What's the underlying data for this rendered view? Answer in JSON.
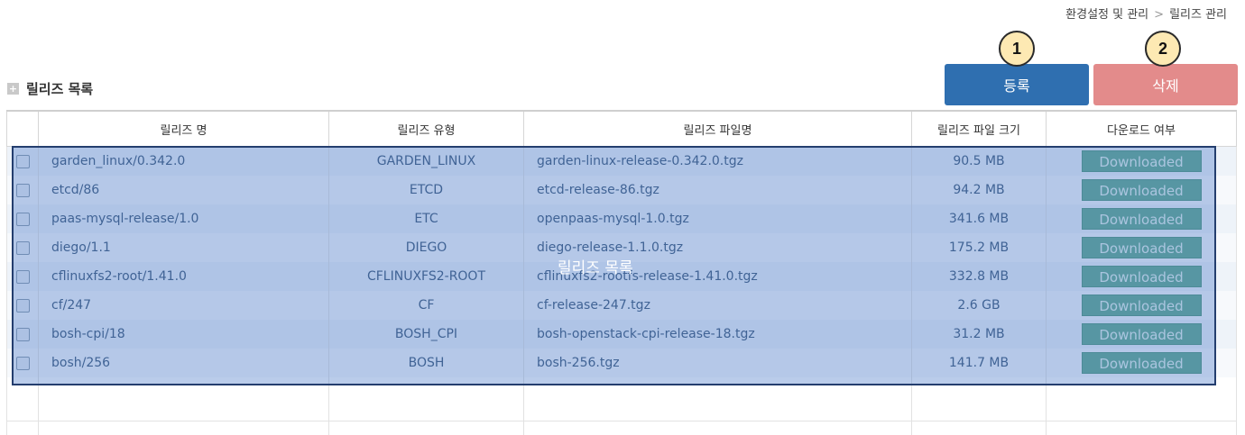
{
  "breadcrumb": {
    "parent": "환경설정 및 관리",
    "separator": ">",
    "current": "릴리즈 관리"
  },
  "section": {
    "title": "릴리즈 목록",
    "icon": "plus-icon"
  },
  "buttons": {
    "register": "등록",
    "delete": "삭제"
  },
  "annotations": {
    "badge1": "1",
    "badge2": "2"
  },
  "overlay_label": "릴리즈 목록",
  "table": {
    "headers": {
      "name": "릴리즈 명",
      "type": "릴리즈 유형",
      "file": "릴리즈 파일명",
      "size": "릴리즈 파일 크기",
      "download": "다운로드 여부"
    },
    "rows": [
      {
        "name": "garden_linux/0.342.0",
        "type": "GARDEN_LINUX",
        "file": "garden-linux-release-0.342.0.tgz",
        "size": "90.5 MB",
        "download": "Downloaded"
      },
      {
        "name": "etcd/86",
        "type": "ETCD",
        "file": "etcd-release-86.tgz",
        "size": "94.2 MB",
        "download": "Downloaded"
      },
      {
        "name": "paas-mysql-release/1.0",
        "type": "ETC",
        "file": "openpaas-mysql-1.0.tgz",
        "size": "341.6 MB",
        "download": "Downloaded"
      },
      {
        "name": "diego/1.1",
        "type": "DIEGO",
        "file": "diego-release-1.1.0.tgz",
        "size": "175.2 MB",
        "download": "Downloaded"
      },
      {
        "name": "cflinuxfs2-root/1.41.0",
        "type": "CFLINUXFS2-ROOT",
        "file": "cflinuxfs2-rootfs-release-1.41.0.tgz",
        "size": "332.8 MB",
        "download": "Downloaded"
      },
      {
        "name": "cf/247",
        "type": "CF",
        "file": "cf-release-247.tgz",
        "size": "2.6 GB",
        "download": "Downloaded"
      },
      {
        "name": "bosh-cpi/18",
        "type": "BOSH_CPI",
        "file": "bosh-openstack-cpi-release-18.tgz",
        "size": "31.2 MB",
        "download": "Downloaded"
      },
      {
        "name": "bosh/256",
        "type": "BOSH",
        "file": "bosh-256.tgz",
        "size": "141.7 MB",
        "download": "Downloaded"
      }
    ]
  }
}
